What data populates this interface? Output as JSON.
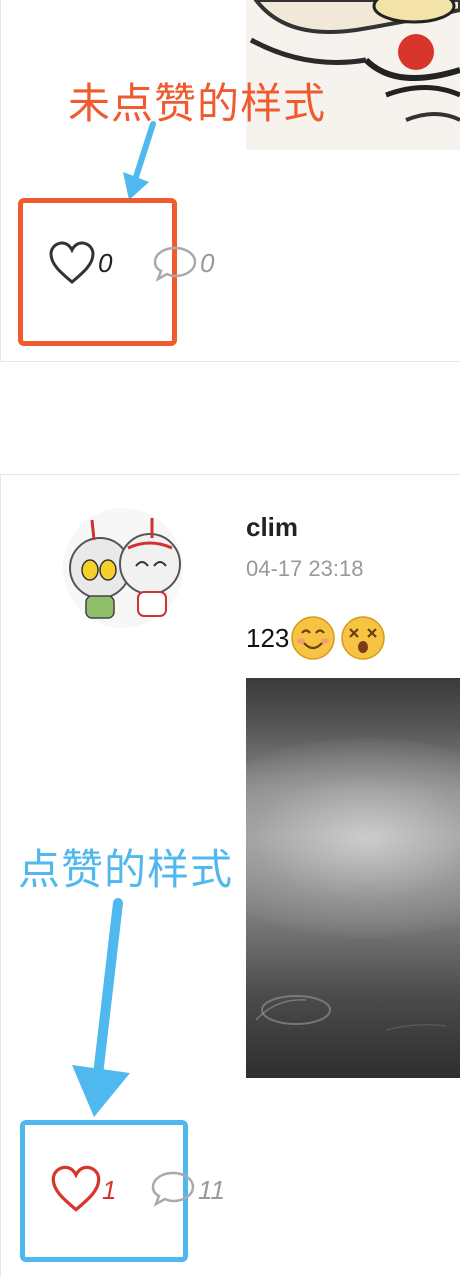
{
  "annotations": {
    "unliked_label": "未点赞的样式",
    "liked_label": "点赞的样式",
    "unliked_color": "#ef5a2f",
    "liked_color": "#4fb8ee"
  },
  "post_1": {
    "like_count": "0",
    "comment_count": "0",
    "liked": false
  },
  "post_2": {
    "username": "clim",
    "timestamp": "04-17 23:18",
    "text": "123",
    "emojis": [
      "smiling-face-emoji",
      "dizzy-face-emoji"
    ],
    "like_count": "1",
    "comment_count": "11",
    "liked": true
  },
  "colors": {
    "liked_heart": "#d9362b",
    "unliked_heart": "#333333",
    "comment_icon": "#aaaaaa",
    "count_gray": "#999999"
  }
}
